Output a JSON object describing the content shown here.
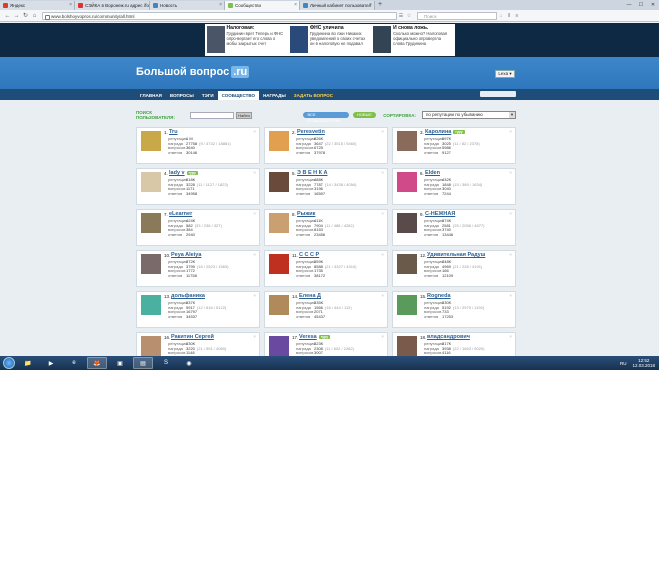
{
  "browser": {
    "tabs": [
      {
        "label": "Яндекс",
        "color": "#e23b2a",
        "active": false
      },
      {
        "label": "СЭЙКА в Воронеж.ru адрес ло",
        "color": "#d33",
        "active": false
      },
      {
        "label": "Новость",
        "color": "#3d87c9",
        "active": false
      },
      {
        "label": "Сообщество",
        "color": "#7fbf4a",
        "active": true
      },
      {
        "label": "Личный кабинет пользовател",
        "color": "#3d87c9",
        "active": false
      }
    ],
    "url": "www.bolshoyvopros.ru/community/all.html",
    "search_placeholder": "Поиск"
  },
  "ads": [
    {
      "title": "Налоговая:",
      "text": "Грудинин врет Теперь и ФНС опро-вергает его слова о мобы закрытых счет",
      "color": "#4a5568"
    },
    {
      "title": "ФНС уличила",
      "text": "Грудинина во лжи Никаких уведомлений о своих счетах он в налоговую не подавал",
      "color": "#2a4a7a"
    },
    {
      "title": "И снова ложь.",
      "text": "Сколько можно? Налоговая официально опровергла слова Грудинина",
      "color": "#345"
    }
  ],
  "site": {
    "logo_text": "Большой вопрос",
    "logo_suffix": ".ru",
    "user_button": "Lexa ▾",
    "menu": [
      {
        "label": "ГЛАВНАЯ",
        "active": false
      },
      {
        "label": "ВОПРОСЫ",
        "active": false
      },
      {
        "label": "ТЭГИ",
        "active": false
      },
      {
        "label": "СООБЩЕСТВО",
        "active": true
      },
      {
        "label": "НАГРАДЫ",
        "active": false
      },
      {
        "label": "ЗАДАТЬ ВОПРОС",
        "active": false,
        "ask": true
      }
    ],
    "filters": {
      "search_label": "ПОИСК ПОЛЬЗОВАТЕЛЯ:",
      "search_button": "Найти",
      "pill_all": "ВСЕ ПОЛЬЗОВАТЕЛИ",
      "pill_new": "НОВЫЕ",
      "sort_label": "СОРТИРОВКА:",
      "sort_value": "по репутации по убыванию"
    },
    "stat_labels": [
      "репутация",
      "награда",
      "вопросов",
      "ответов"
    ]
  },
  "users": [
    {
      "rank": "1.",
      "name": "Tru",
      "badge": "",
      "stats": [
        "1 М",
        "27758",
        "3640",
        "30146"
      ],
      "deltas": [
        "",
        "(9 / 3732 / 18881)",
        "",
        ""
      ],
      "avatar": "#c9a84a"
    },
    {
      "rank": "2.",
      "name": "Peresvetin",
      "badge": "",
      "stats": [
        "826K",
        "3647",
        "6725",
        "37978"
      ],
      "deltas": [
        "",
        "(22 / 3515 / 5460)",
        "",
        ""
      ],
      "avatar": "#e0a050"
    },
    {
      "rank": "3.",
      "name": "Каролина",
      "badge": "гуру",
      "stats": [
        "597K",
        "3025",
        "5986",
        "9127"
      ],
      "deltas": [
        "",
        "(11 / 82 / 2375)",
        "",
        ""
      ],
      "avatar": "#8a6a5a"
    },
    {
      "rank": "4.",
      "name": "lady v",
      "badge": "гуру",
      "stats": [
        "518K",
        "3228",
        "1171",
        "34958"
      ],
      "deltas": [
        "",
        "(11 / 1127 / 1823)",
        "",
        ""
      ],
      "avatar": "#d8c8a8"
    },
    {
      "rank": "5.",
      "name": "Э В Е Н К А",
      "badge": "",
      "stats": [
        "488K",
        "7787",
        "3196",
        "16597"
      ],
      "deltas": [
        "",
        "(14 / 3438 / 4054)",
        "",
        ""
      ],
      "avatar": "#6a4a3a"
    },
    {
      "rank": "6.",
      "name": "Elden",
      "badge": "",
      "stats": [
        "432K",
        "1848",
        "3040",
        "7244"
      ],
      "deltas": [
        "",
        "(15 / 389 / 1634)",
        "",
        ""
      ],
      "avatar": "#d04a8a"
    },
    {
      "rank": "7.",
      "name": "eLearner",
      "badge": "",
      "stats": [
        "424K",
        "582",
        "384",
        "2940"
      ],
      "deltas": [
        "",
        "(33 / 238 / 327)",
        "",
        ""
      ],
      "avatar": "#8a7a5a"
    },
    {
      "rank": "8.",
      "name": "Рыжик",
      "badge": "",
      "stats": [
        "411K",
        "7904",
        "8153",
        "23456"
      ],
      "deltas": [
        "",
        "(11 / 486 / 4262)",
        "",
        ""
      ],
      "avatar": "#caa070"
    },
    {
      "rank": "9.",
      "name": "С-НЕЖНАЯ",
      "badge": "",
      "stats": [
        "374K",
        "2581",
        "3740",
        "13446"
      ],
      "deltas": [
        "",
        "(25 / 2058 / 4877)",
        "",
        ""
      ],
      "avatar": "#5a4a4a"
    },
    {
      "rank": "10.",
      "name": "Peya Aleiya",
      "badge": "",
      "stats": [
        "372K",
        "3799",
        "1772",
        "11758"
      ],
      "deltas": [
        "",
        "(16 / 2523 / 1563)",
        "",
        ""
      ],
      "avatar": "#7a6a6a"
    },
    {
      "rank": "11.",
      "name": "С С С Р",
      "badge": "",
      "stats": [
        "359K",
        "8588",
        "1735",
        "38172"
      ],
      "deltas": [
        "",
        "(21 / 3327 / 4310)",
        "",
        ""
      ],
      "avatar": "#c03020"
    },
    {
      "rank": "12.",
      "name": "Удивительная Радуш",
      "badge": "",
      "stats": [
        "348K",
        "4969",
        "166",
        "12109"
      ],
      "deltas": [
        "",
        "(21 / 228 / 4191)",
        "",
        ""
      ],
      "avatar": "#6a5a4a"
    },
    {
      "rank": "13.",
      "name": "дольфаника",
      "badge": "",
      "stats": [
        "337K",
        "5917",
        "16797",
        "34537"
      ],
      "deltas": [
        "",
        "(12 / 616 / 5122)",
        "",
        ""
      ],
      "avatar": "#4ab0a0"
    },
    {
      "rank": "14.",
      "name": "Елена Д",
      "badge": "",
      "stats": [
        "335K",
        "1566",
        "2071",
        "45437"
      ],
      "deltas": [
        "",
        "(16 / 444 / 112)",
        "",
        ""
      ],
      "avatar": "#b08a5a"
    },
    {
      "rank": "15.",
      "name": "Rogneda",
      "badge": "",
      "stats": [
        "330K",
        "5192",
        "733",
        "17253"
      ],
      "deltas": [
        "",
        "(13 / 2970 / 1192)",
        "",
        ""
      ],
      "avatar": "#5a9a5a"
    },
    {
      "rank": "16.",
      "name": "Ракитин Сергей",
      "badge": "",
      "stats": [
        "330K",
        "3220",
        "1148",
        "15741"
      ],
      "deltas": [
        "",
        "(21 / 591 / 4080)",
        "",
        ""
      ],
      "avatar": "#b89070"
    },
    {
      "rank": "17.",
      "name": "Veresa",
      "badge": "гуру",
      "stats": [
        "323K",
        "2308",
        "3007",
        "7652"
      ],
      "deltas": [
        "",
        "(11 / 602 / 2262)",
        "",
        ""
      ],
      "avatar": "#6a4aa0"
    },
    {
      "rank": "18.",
      "name": "владсандрович",
      "badge": "",
      "stats": [
        "317K",
        "3938",
        "4116",
        "16832"
      ],
      "deltas": [
        "",
        "(22 / 1663 / 5020)",
        "",
        ""
      ],
      "avatar": "#7a5a4a"
    }
  ],
  "taskbar": {
    "items": [
      {
        "name": "explorer-icon",
        "glyph": "📁",
        "active": false
      },
      {
        "name": "media-icon",
        "glyph": "▶",
        "active": false
      },
      {
        "name": "ie-icon",
        "glyph": "e",
        "active": false
      },
      {
        "name": "firefox-icon",
        "glyph": "🦊",
        "active": true
      },
      {
        "name": "app-icon",
        "glyph": "▣",
        "active": false
      },
      {
        "name": "doc-icon",
        "glyph": "▤",
        "active": true
      },
      {
        "name": "skype-icon",
        "glyph": "S",
        "active": false
      },
      {
        "name": "photo-icon",
        "glyph": "◉",
        "active": false
      }
    ],
    "lang": "RU",
    "time": "12:52",
    "date": "12.03.2018"
  }
}
